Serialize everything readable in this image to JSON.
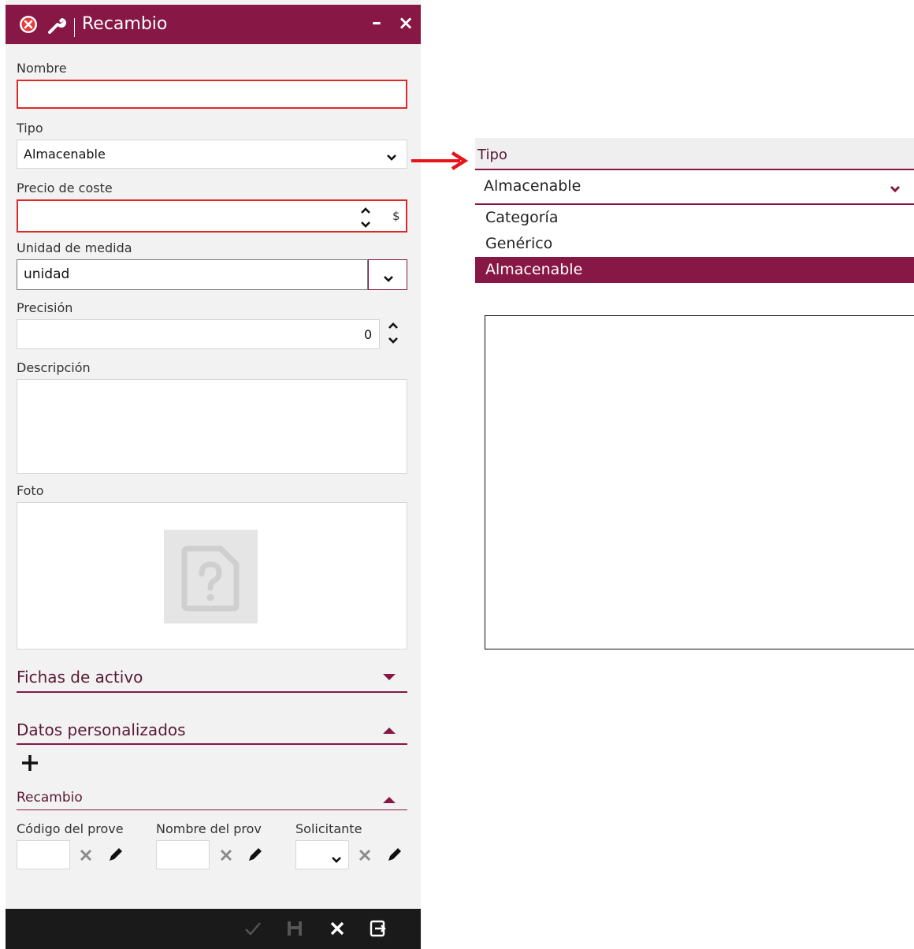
{
  "window": {
    "title": "Recambio",
    "close_icon": "close-circle-icon",
    "tool_icon": "wrench-icon",
    "minimize_label": "–",
    "close_label": "×"
  },
  "form": {
    "nombre": {
      "label": "Nombre",
      "value": ""
    },
    "tipo": {
      "label": "Tipo",
      "value": "Almacenable"
    },
    "precio": {
      "label": "Precio de coste",
      "value": "",
      "currency": "$"
    },
    "unidad": {
      "label": "Unidad de medida",
      "value": "unidad"
    },
    "precision": {
      "label": "Precisión",
      "value": "0"
    },
    "descripcion": {
      "label": "Descripción",
      "value": ""
    },
    "foto": {
      "label": "Foto",
      "placeholder_icon": "unknown-file-icon"
    }
  },
  "sections": {
    "fichas": {
      "title": "Fichas de activo",
      "state": "collapsed"
    },
    "datos": {
      "title": "Datos personalizados",
      "state": "expanded",
      "add_label": "+"
    },
    "recambio": {
      "title": "Recambio",
      "state": "expanded",
      "columns": [
        {
          "label": "Código del prove",
          "type": "text"
        },
        {
          "label": "Nombre del prov",
          "type": "text"
        },
        {
          "label": "Solicitante",
          "type": "select"
        }
      ]
    }
  },
  "footer": {
    "buttons": [
      "check-icon",
      "save-icon",
      "close-icon",
      "exit-icon"
    ]
  },
  "dropdown_zoom": {
    "label": "Tipo",
    "selected": "Almacenable",
    "options": [
      {
        "label": "Categoría",
        "active": false
      },
      {
        "label": "Genérico",
        "active": false
      },
      {
        "label": "Almacenable",
        "active": true
      }
    ]
  },
  "colors": {
    "accent": "#871745",
    "required": "#e02828",
    "arrow": "#e8141a",
    "footer": "#1a1a1a"
  }
}
